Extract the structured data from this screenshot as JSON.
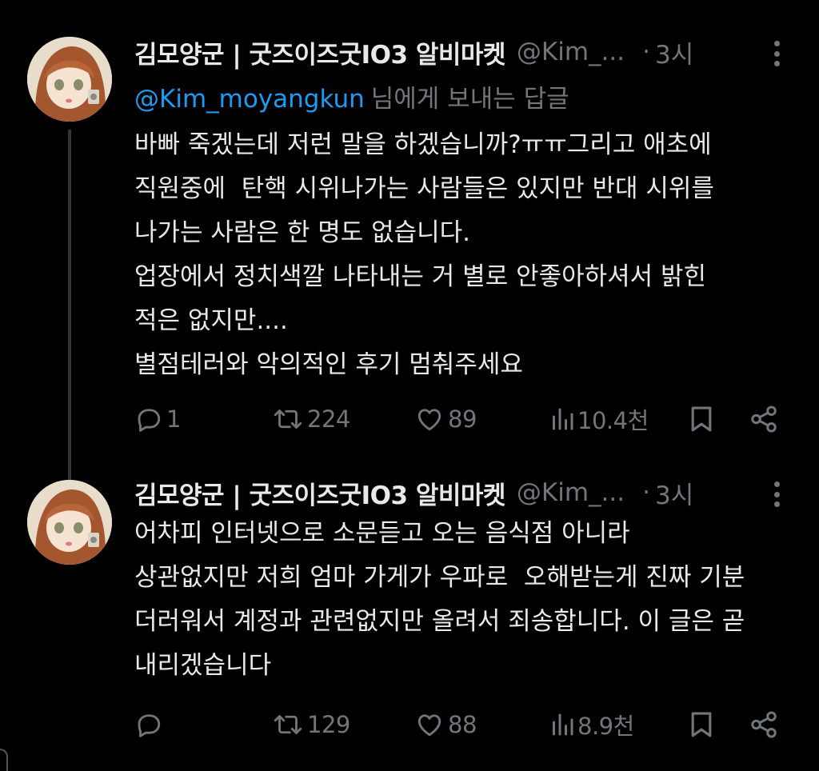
{
  "tweets": [
    {
      "display_name": "김모양군 | 굿즈이즈굿IO3 알비마켓",
      "handle": "@Kim_...",
      "dot": "·",
      "time": "3시",
      "reply_to_handle": "@Kim_moyangkun",
      "reply_to_suffix": "님에게 보내는 답글",
      "body_lines": [
        "바빠 죽겠는데 저런 말을 하겠습니까?ㅠㅠ그리고 애초에",
        "직원중에  탄핵 시위나가는 사람들은 있지만 반대 시위를",
        "나가는 사람은 한 명도 없습니다.",
        "업장에서 정치색깔 나타내는 거 별로 안좋아하셔서 밝힌",
        "적은 없지만....",
        "별점테러와 악의적인 후기 멈춰주세요"
      ],
      "replies": "1",
      "retweets": "224",
      "likes": "89",
      "views": "10.4천"
    },
    {
      "display_name": "김모양군 | 굿즈이즈굿IO3 알비마켓",
      "handle": "@Kim_...",
      "dot": "·",
      "time": "3시",
      "body_lines": [
        "어차피 인터넷으로 소문듣고 오는 음식점 아니라",
        "상관없지만 저희 엄마 가게가 우파로  오해받는게 진짜 기분",
        "더러워서 계정과 관련없지만 올려서 죄송합니다. 이 글은 곧",
        "내리겠습니다"
      ],
      "replies": "",
      "retweets": "129",
      "likes": "88",
      "views": "8.9천"
    }
  ],
  "colors": {
    "background": "#000000",
    "text": "#e7e9ea",
    "muted": "#71767b",
    "link": "#1d9bf0"
  }
}
